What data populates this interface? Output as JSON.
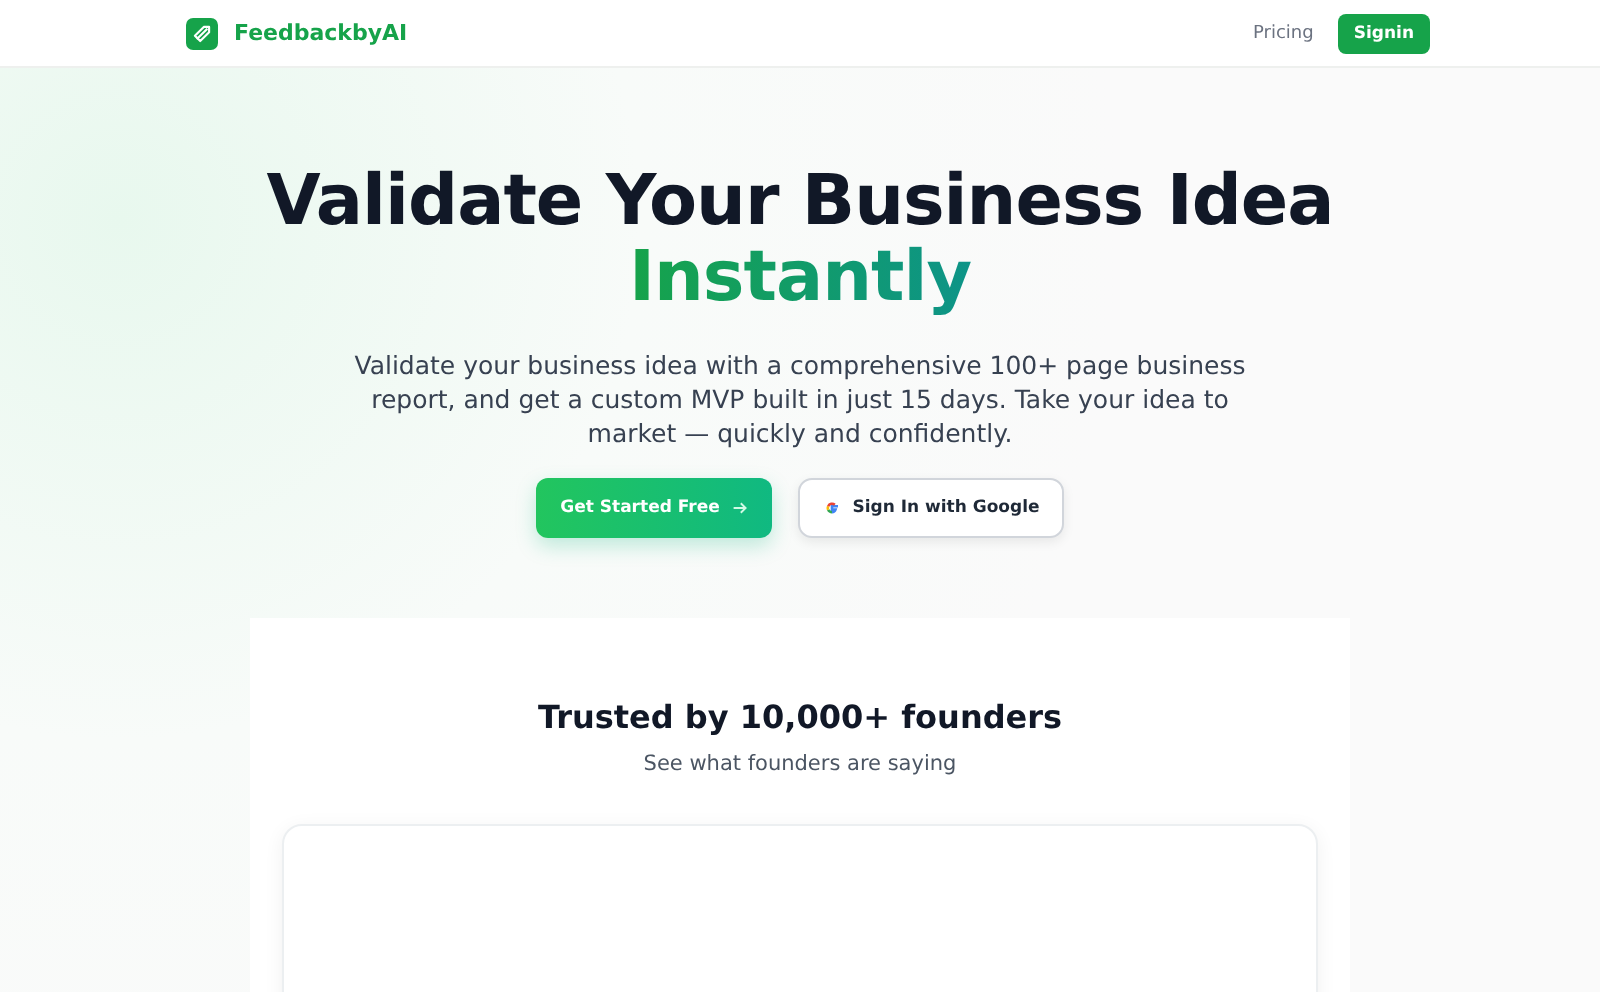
{
  "header": {
    "brand": "FeedbackbyAI",
    "nav": [
      {
        "label": "Pricing",
        "kind": "link"
      },
      {
        "label": "Signin",
        "kind": "button"
      }
    ]
  },
  "hero": {
    "title_line1": "Validate Your Business Idea",
    "title_line2": "Instantly",
    "subtitle": "Validate your business idea with a comprehensive 100+ page business report, and get a custom MVP built in just 15 days. Take your idea to market — quickly and confidently.",
    "primary_button": "Get Started Free",
    "google_button": "Sign In with Google"
  },
  "testimonials": {
    "title": "Trusted by 10,000+ founders",
    "subtitle": "See what founders are saying"
  }
}
